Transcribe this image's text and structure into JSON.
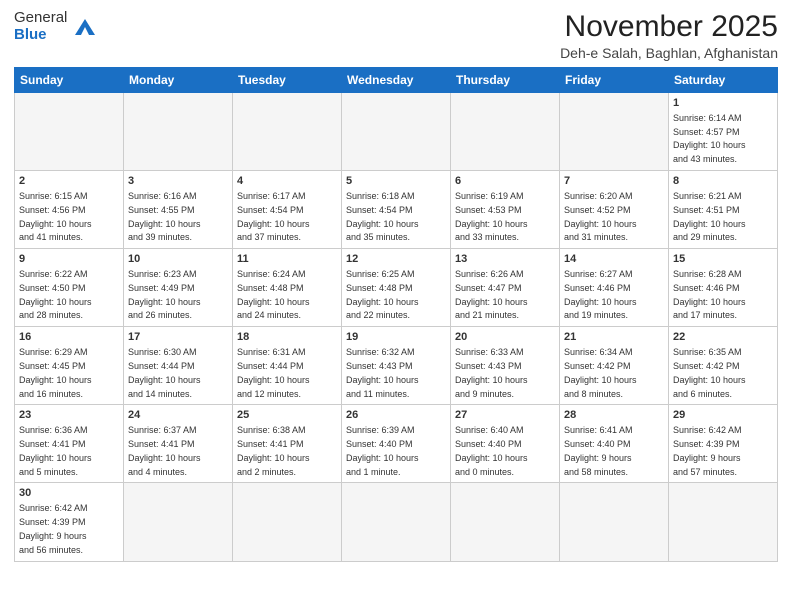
{
  "header": {
    "logo_line1": "General",
    "logo_line2": "Blue",
    "month_year": "November 2025",
    "location": "Deh-e Salah, Baghlan, Afghanistan"
  },
  "weekdays": [
    "Sunday",
    "Monday",
    "Tuesday",
    "Wednesday",
    "Thursday",
    "Friday",
    "Saturday"
  ],
  "weeks": [
    [
      {
        "day": "",
        "info": ""
      },
      {
        "day": "",
        "info": ""
      },
      {
        "day": "",
        "info": ""
      },
      {
        "day": "",
        "info": ""
      },
      {
        "day": "",
        "info": ""
      },
      {
        "day": "",
        "info": ""
      },
      {
        "day": "1",
        "info": "Sunrise: 6:14 AM\nSunset: 4:57 PM\nDaylight: 10 hours\nand 43 minutes."
      }
    ],
    [
      {
        "day": "2",
        "info": "Sunrise: 6:15 AM\nSunset: 4:56 PM\nDaylight: 10 hours\nand 41 minutes."
      },
      {
        "day": "3",
        "info": "Sunrise: 6:16 AM\nSunset: 4:55 PM\nDaylight: 10 hours\nand 39 minutes."
      },
      {
        "day": "4",
        "info": "Sunrise: 6:17 AM\nSunset: 4:54 PM\nDaylight: 10 hours\nand 37 minutes."
      },
      {
        "day": "5",
        "info": "Sunrise: 6:18 AM\nSunset: 4:54 PM\nDaylight: 10 hours\nand 35 minutes."
      },
      {
        "day": "6",
        "info": "Sunrise: 6:19 AM\nSunset: 4:53 PM\nDaylight: 10 hours\nand 33 minutes."
      },
      {
        "day": "7",
        "info": "Sunrise: 6:20 AM\nSunset: 4:52 PM\nDaylight: 10 hours\nand 31 minutes."
      },
      {
        "day": "8",
        "info": "Sunrise: 6:21 AM\nSunset: 4:51 PM\nDaylight: 10 hours\nand 29 minutes."
      }
    ],
    [
      {
        "day": "9",
        "info": "Sunrise: 6:22 AM\nSunset: 4:50 PM\nDaylight: 10 hours\nand 28 minutes."
      },
      {
        "day": "10",
        "info": "Sunrise: 6:23 AM\nSunset: 4:49 PM\nDaylight: 10 hours\nand 26 minutes."
      },
      {
        "day": "11",
        "info": "Sunrise: 6:24 AM\nSunset: 4:48 PM\nDaylight: 10 hours\nand 24 minutes."
      },
      {
        "day": "12",
        "info": "Sunrise: 6:25 AM\nSunset: 4:48 PM\nDaylight: 10 hours\nand 22 minutes."
      },
      {
        "day": "13",
        "info": "Sunrise: 6:26 AM\nSunset: 4:47 PM\nDaylight: 10 hours\nand 21 minutes."
      },
      {
        "day": "14",
        "info": "Sunrise: 6:27 AM\nSunset: 4:46 PM\nDaylight: 10 hours\nand 19 minutes."
      },
      {
        "day": "15",
        "info": "Sunrise: 6:28 AM\nSunset: 4:46 PM\nDaylight: 10 hours\nand 17 minutes."
      }
    ],
    [
      {
        "day": "16",
        "info": "Sunrise: 6:29 AM\nSunset: 4:45 PM\nDaylight: 10 hours\nand 16 minutes."
      },
      {
        "day": "17",
        "info": "Sunrise: 6:30 AM\nSunset: 4:44 PM\nDaylight: 10 hours\nand 14 minutes."
      },
      {
        "day": "18",
        "info": "Sunrise: 6:31 AM\nSunset: 4:44 PM\nDaylight: 10 hours\nand 12 minutes."
      },
      {
        "day": "19",
        "info": "Sunrise: 6:32 AM\nSunset: 4:43 PM\nDaylight: 10 hours\nand 11 minutes."
      },
      {
        "day": "20",
        "info": "Sunrise: 6:33 AM\nSunset: 4:43 PM\nDaylight: 10 hours\nand 9 minutes."
      },
      {
        "day": "21",
        "info": "Sunrise: 6:34 AM\nSunset: 4:42 PM\nDaylight: 10 hours\nand 8 minutes."
      },
      {
        "day": "22",
        "info": "Sunrise: 6:35 AM\nSunset: 4:42 PM\nDaylight: 10 hours\nand 6 minutes."
      }
    ],
    [
      {
        "day": "23",
        "info": "Sunrise: 6:36 AM\nSunset: 4:41 PM\nDaylight: 10 hours\nand 5 minutes."
      },
      {
        "day": "24",
        "info": "Sunrise: 6:37 AM\nSunset: 4:41 PM\nDaylight: 10 hours\nand 4 minutes."
      },
      {
        "day": "25",
        "info": "Sunrise: 6:38 AM\nSunset: 4:41 PM\nDaylight: 10 hours\nand 2 minutes."
      },
      {
        "day": "26",
        "info": "Sunrise: 6:39 AM\nSunset: 4:40 PM\nDaylight: 10 hours\nand 1 minute."
      },
      {
        "day": "27",
        "info": "Sunrise: 6:40 AM\nSunset: 4:40 PM\nDaylight: 10 hours\nand 0 minutes."
      },
      {
        "day": "28",
        "info": "Sunrise: 6:41 AM\nSunset: 4:40 PM\nDaylight: 9 hours\nand 58 minutes."
      },
      {
        "day": "29",
        "info": "Sunrise: 6:42 AM\nSunset: 4:39 PM\nDaylight: 9 hours\nand 57 minutes."
      }
    ],
    [
      {
        "day": "30",
        "info": "Sunrise: 6:42 AM\nSunset: 4:39 PM\nDaylight: 9 hours\nand 56 minutes."
      },
      {
        "day": "",
        "info": ""
      },
      {
        "day": "",
        "info": ""
      },
      {
        "day": "",
        "info": ""
      },
      {
        "day": "",
        "info": ""
      },
      {
        "day": "",
        "info": ""
      },
      {
        "day": "",
        "info": ""
      }
    ]
  ]
}
